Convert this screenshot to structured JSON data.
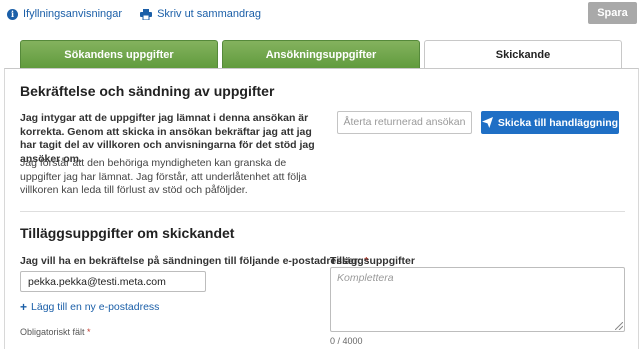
{
  "top_links": {
    "instructions": "Ifyllningsanvisningar",
    "print_summary": "Skriv ut sammandrag"
  },
  "save_label": "Spara",
  "tabs": [
    {
      "label": "Sökandens uppgifter",
      "state": "completed"
    },
    {
      "label": "Ansökningsuppgifter",
      "state": "completed"
    },
    {
      "label": "Skickande",
      "state": "active"
    }
  ],
  "confirmation": {
    "title": "Bekräftelse och sändning av uppgifter",
    "bold_text": "Jag intygar att de uppgifter jag lämnat i denna ansökan är korrekta. Genom att skicka in ansökan bekräftar jag att jag har tagit del av villkoren och anvisningarna för det stöd jag ansöker om.",
    "normal_text": "Jag förstår att den behöriga myndigheten kan granska de uppgifter jag har lämnat. Jag förstår, att underlåtenhet att följa villkoren kan leda till förlust av stöd och påföljder.",
    "restore_label": "Återta returnerad ansökan",
    "submit_label": "Skicka till handläggning"
  },
  "additional": {
    "title": "Tilläggsuppgifter om skickandet",
    "email_label": "Jag vill ha en bekräftelse på sändningen till följande e-postadresser:",
    "required_mark": "*",
    "email_value": "pekka.pekka@testi.meta.com",
    "add_email_label": "Lägg till en ny e-postadress",
    "required_note": "Obligatoriskt fält",
    "extra_label": "Tilläggsuppgifter",
    "extra_placeholder": "Komplettera",
    "char_counter": "0 / 4000"
  },
  "colors": {
    "link": "#1b5fa8",
    "primary_button": "#1f6fc5",
    "tab_completed": "#6fa84a",
    "save_disabled": "#a9a9a9",
    "required": "#c0392b"
  },
  "icons": {
    "instructions": "info-icon",
    "print": "printer-icon",
    "submit": "paper-plane-icon",
    "add": "plus-icon"
  }
}
